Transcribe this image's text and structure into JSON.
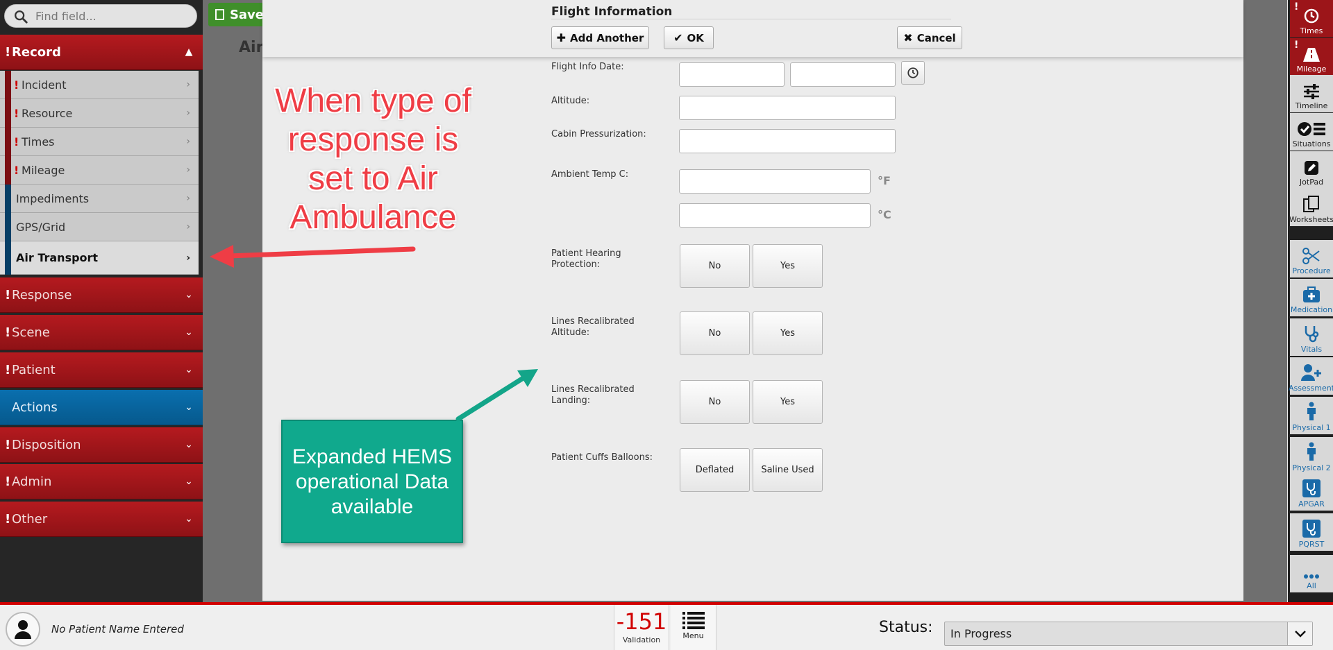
{
  "search": {
    "placeholder": "Find field..."
  },
  "toolbar": {
    "save_label": "Save"
  },
  "underlying": {
    "title": "Air"
  },
  "sidebar": {
    "record": {
      "label": "Record",
      "required": "!"
    },
    "record_items": [
      {
        "label": "Incident",
        "required": "!"
      },
      {
        "label": "Resource",
        "required": "!"
      },
      {
        "label": "Times",
        "required": "!"
      },
      {
        "label": "Mileage",
        "required": "!"
      },
      {
        "label": "Impediments",
        "required": ""
      },
      {
        "label": "GPS/Grid",
        "required": ""
      },
      {
        "label": "Air Transport",
        "required": ""
      }
    ],
    "sections": [
      {
        "label": "Response",
        "required": "!"
      },
      {
        "label": "Scene",
        "required": "!"
      },
      {
        "label": "Patient",
        "required": "!"
      },
      {
        "label": "Actions",
        "required": ""
      },
      {
        "label": "Disposition",
        "required": "!"
      },
      {
        "label": "Admin",
        "required": "!"
      },
      {
        "label": "Other",
        "required": "!"
      }
    ],
    "colors": {
      "section_red": "#a4171b",
      "section_blue": "#0a6aa8"
    }
  },
  "modal": {
    "title": "Flight Information",
    "buttons": {
      "add_another": "Add Another",
      "ok": "OK",
      "cancel": "Cancel"
    },
    "fields": {
      "flight_info_date": {
        "label": "Flight Info Date:",
        "date_value": "",
        "time_value": ""
      },
      "altitude": {
        "label": "Altitude:",
        "value": ""
      },
      "cabin_pressurization": {
        "label": "Cabin Pressurization:",
        "value": ""
      },
      "ambient_temp": {
        "label": "Ambient Temp C:",
        "unit_f": "°F",
        "unit_c": "°C",
        "value_f": "",
        "value_c": ""
      },
      "hearing_protection": {
        "label": "Patient Hearing Protection:",
        "options": [
          "No",
          "Yes"
        ]
      },
      "lines_altitude": {
        "label": "Lines Recalibrated Altitude:",
        "options": [
          "No",
          "Yes"
        ]
      },
      "lines_landing": {
        "label": "Lines Recalibrated Landing:",
        "options": [
          "No",
          "Yes"
        ]
      },
      "cuffs_balloons": {
        "label": "Patient Cuffs Balloons:",
        "options": [
          "Deflated",
          "Saline Used"
        ]
      }
    }
  },
  "right_toolbar": {
    "items": [
      {
        "label": "Times",
        "icon": "clock-icon",
        "style": "red"
      },
      {
        "label": "Mileage",
        "icon": "road-icon",
        "style": "red"
      },
      {
        "label": "Timeline",
        "icon": "sliders-icon",
        "style": "dark"
      },
      {
        "label": "Situations",
        "icon": "check-list-icon",
        "style": "dark"
      },
      {
        "label": "JotPad",
        "icon": "pencil-icon",
        "style": "dark"
      },
      {
        "label": "Worksheets",
        "icon": "copy-icon",
        "style": "dark"
      },
      {
        "label": "Procedure",
        "icon": "scissors-icon",
        "style": "blue"
      },
      {
        "label": "Medication",
        "icon": "medkit-icon",
        "style": "blue"
      },
      {
        "label": "Vitals",
        "icon": "stethoscope-icon",
        "style": "blue"
      },
      {
        "label": "Assessment",
        "icon": "user-plus-icon",
        "style": "blue"
      },
      {
        "label": "Physical 1",
        "icon": "person-icon",
        "style": "blue"
      },
      {
        "label": "Physical 2",
        "icon": "person-icon",
        "style": "blue"
      },
      {
        "label": "APGAR",
        "icon": "stethoscope-box-icon",
        "style": "blue"
      },
      {
        "label": "PQRST",
        "icon": "stethoscope-box-icon",
        "style": "blue"
      },
      {
        "label": "All",
        "icon": "ellipsis-icon",
        "style": "blue"
      }
    ]
  },
  "bottom": {
    "patient_name": "No Patient Name Entered",
    "validation_count": "-151",
    "validation_label": "Validation",
    "menu_label": "Menu",
    "status_label": "Status:",
    "status_value": "In Progress"
  },
  "annotations": {
    "note_1": "When type of response is set to Air Ambulance",
    "note_2": "Expanded HEMS operational Data available",
    "colors": {
      "red_text": "#ef3d45",
      "green_box": "#10a98d",
      "arrow_red": "#ef3d45",
      "arrow_green": "#13a589"
    }
  }
}
